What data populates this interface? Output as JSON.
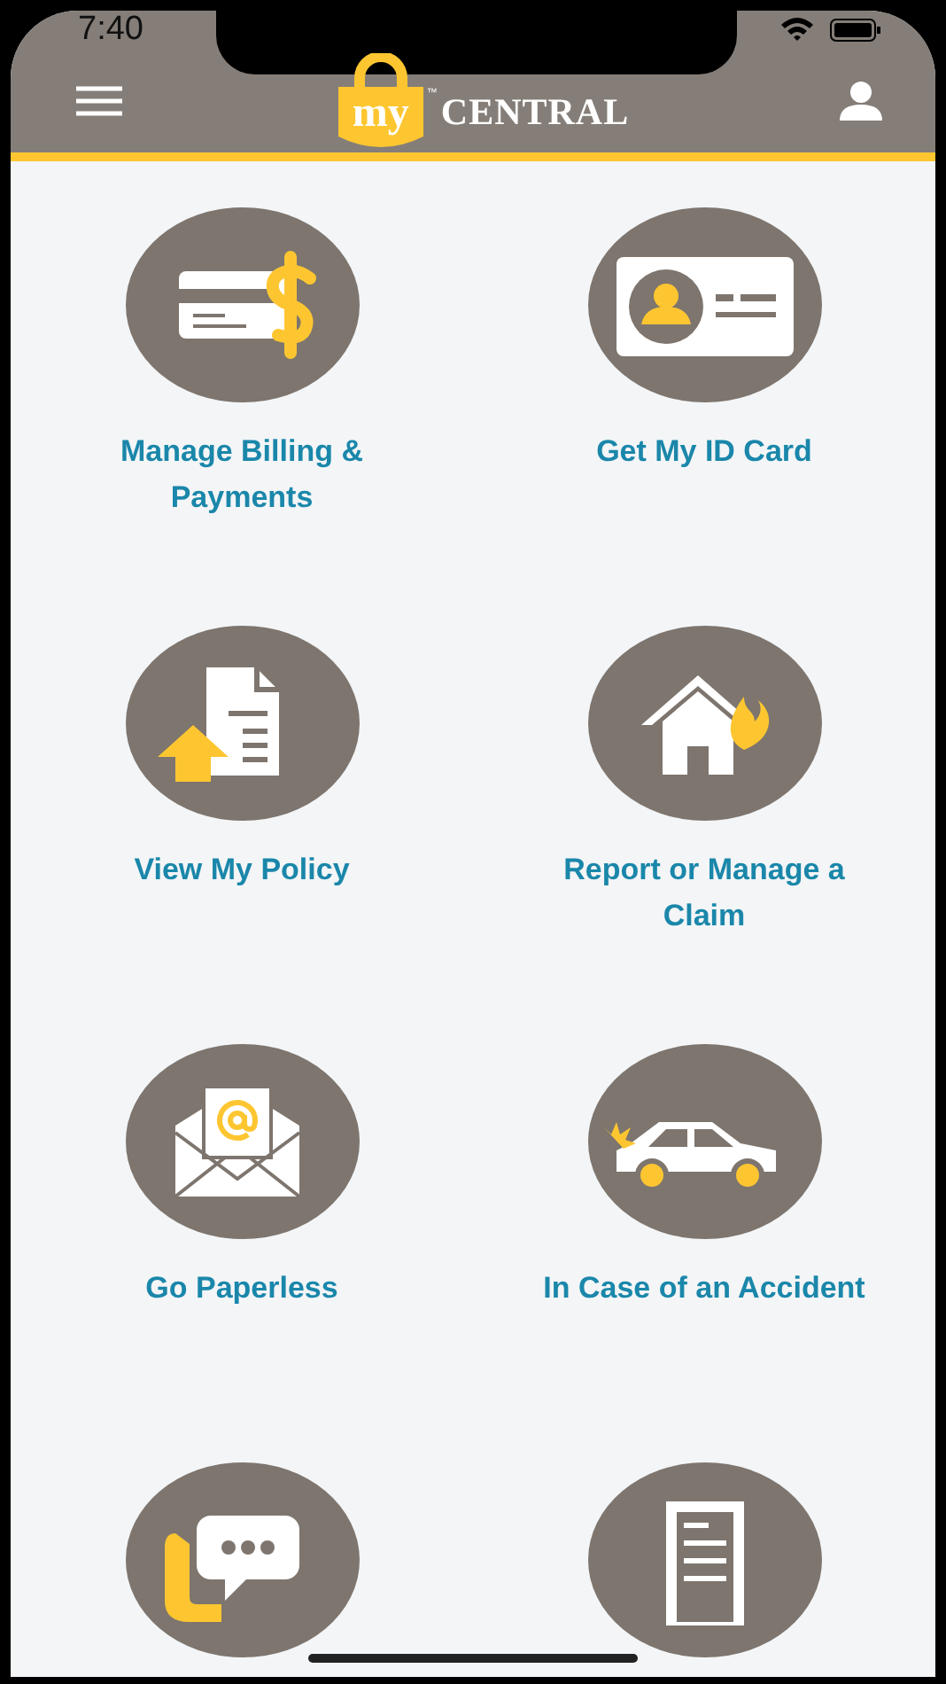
{
  "status_bar": {
    "time": "7:40"
  },
  "header": {
    "logo": {
      "badge": "my",
      "trademark": "™",
      "name": "CENTRAL"
    }
  },
  "tiles": [
    {
      "kind": "billing",
      "label": "Manage Billing & Payments"
    },
    {
      "kind": "id-card",
      "label": "Get My ID Card"
    },
    {
      "kind": "policy",
      "label": "View My Policy"
    },
    {
      "kind": "claim",
      "label": "Report or Manage a Claim"
    },
    {
      "kind": "paperless",
      "label": "Go Paperless"
    },
    {
      "kind": "accident",
      "label": "In Case of an Accident"
    },
    {
      "kind": "chat"
    },
    {
      "kind": "document"
    }
  ]
}
